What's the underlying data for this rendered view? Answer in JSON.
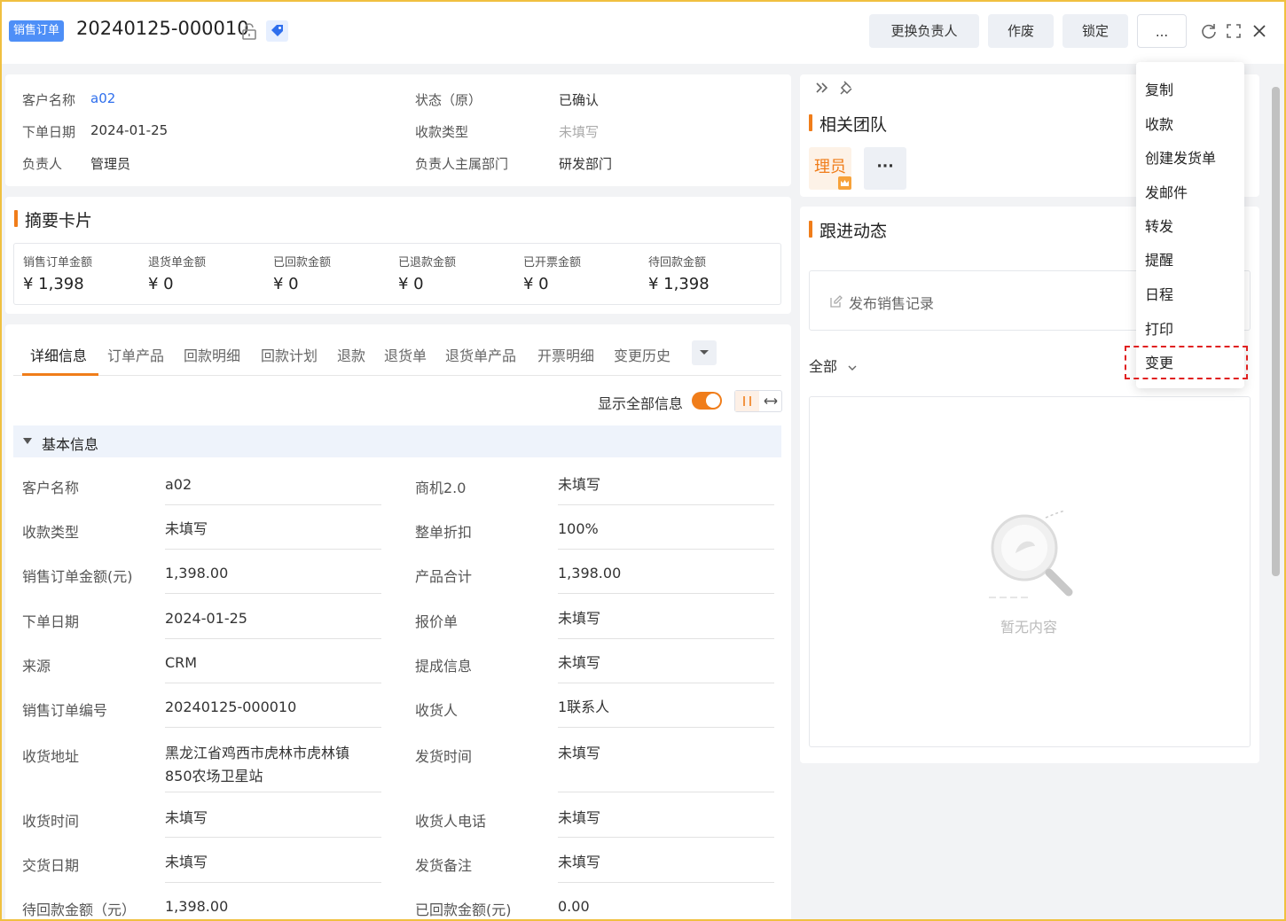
{
  "header": {
    "tag": "销售订单",
    "order_no": "20240125-000010",
    "buttons": [
      "更换负责人",
      "作废",
      "锁定",
      "..."
    ]
  },
  "overview": {
    "left": [
      {
        "label": "客户名称",
        "value": "a02"
      },
      {
        "label": "下单日期",
        "value": "2024-01-25"
      },
      {
        "label": "负责人",
        "value": "管理员"
      }
    ],
    "right": [
      {
        "label": "状态（原）",
        "value": "已确认"
      },
      {
        "label": "收款类型",
        "value": "未填写"
      },
      {
        "label": "负责人主属部门",
        "value": "研发部门"
      }
    ]
  },
  "summary": {
    "title": "摘要卡片",
    "items": [
      {
        "label": "销售订单金额",
        "value": "¥ 1,398"
      },
      {
        "label": "退货单金额",
        "value": "¥ 0"
      },
      {
        "label": "已回款金额",
        "value": "¥ 0"
      },
      {
        "label": "已退款金额",
        "value": "¥ 0"
      },
      {
        "label": "已开票金额",
        "value": "¥ 0"
      },
      {
        "label": "待回款金额",
        "value": "¥ 1,398"
      }
    ]
  },
  "tabs": [
    "详细信息",
    "订单产品",
    "回款明细",
    "回款计划",
    "退款",
    "退货单",
    "退货单产品",
    "开票明细",
    "变更历史"
  ],
  "show_all": {
    "label": "显示全部信息",
    "on": true
  },
  "basic": {
    "title": "基本信息",
    "rows": [
      {
        "l_label": "客户名称",
        "l_value": "a02",
        "r_label": "商机2.0",
        "r_value": "未填写"
      },
      {
        "l_label": "收款类型",
        "l_value": "未填写",
        "r_label": "整单折扣",
        "r_value": "100%"
      },
      {
        "l_label": "销售订单金额(元)",
        "l_value": "1,398.00",
        "r_label": "产品合计",
        "r_value": "1,398.00"
      },
      {
        "l_label": "下单日期",
        "l_value": "2024-01-25",
        "r_label": "报价单",
        "r_value": "未填写"
      },
      {
        "l_label": "来源",
        "l_value": "CRM",
        "r_label": "提成信息",
        "r_value": "未填写"
      },
      {
        "l_label": "销售订单编号",
        "l_value": "20240125-000010",
        "r_label": "收货人",
        "r_value": "1联系人"
      },
      {
        "l_label": "收货地址",
        "l_value_1": "黑龙江省鸡西市虎林市虎林镇",
        "l_value_2": "850农场卫星站",
        "r_label": "发货时间",
        "r_value": "未填写"
      },
      {
        "l_label": "收货时间",
        "l_value": "未填写",
        "r_label": "收货人电话",
        "r_value": "未填写"
      },
      {
        "l_label": "交货日期",
        "l_value": "未填写",
        "r_label": "发货备注",
        "r_value": "未填写"
      },
      {
        "l_label": "待回款金额（元）",
        "l_value": "1,398.00",
        "r_label": "已回款金额(元)",
        "r_value": "0.00"
      }
    ]
  },
  "team": {
    "title": "相关团队",
    "member": "理员",
    "more": "···"
  },
  "follow": {
    "title": "跟进动态",
    "post": "发布销售记录",
    "filter": "全部",
    "empty": "暂无内容"
  },
  "dropdown": {
    "items": [
      "复制",
      "收款",
      "创建发货单",
      "发邮件",
      "转发",
      "提醒",
      "日程",
      "打印",
      "变更"
    ],
    "highlighted": "变更"
  },
  "colors": {
    "accent": "#f07d1a",
    "link": "#2f6fed",
    "tag": "#4e8ff7"
  }
}
